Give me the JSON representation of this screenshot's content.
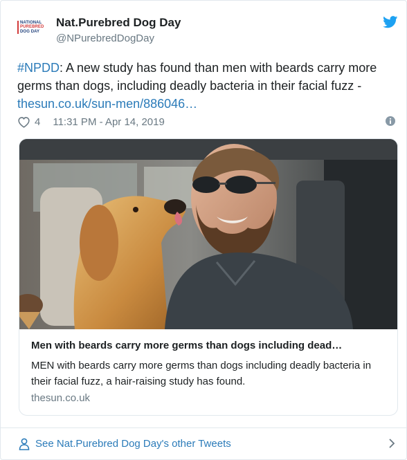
{
  "author": {
    "name": "Nat.Purebred Dog Day",
    "handle": "@NPurebredDogDay",
    "avatar_lines": [
      "NATIONAL",
      "PUREBRED",
      "DOG DAY"
    ]
  },
  "tweet": {
    "hashtag": "#NPDD",
    "text": ": A new study has found than men with beards carry more germs than dogs, including deadly bacteria in their facial fuzz - ",
    "link": "thesun.co.uk/sun-men/886046…",
    "likes": "4",
    "timestamp": "11:31 PM - Apr 14, 2019"
  },
  "card": {
    "title": "Men with beards carry more germs than dogs including dead…",
    "description": "MEN with beards carry more germs than dogs including deadly bacteria in their facial fuzz, a hair-raising study has found.",
    "domain": "thesun.co.uk"
  },
  "footer": {
    "label": "See Nat.Purebred Dog Day's other Tweets"
  },
  "icons": {
    "logo": "twitter-bird-icon",
    "like": "heart-icon",
    "info": "info-icon",
    "profile": "person-icon",
    "more": "chevron-right-icon"
  },
  "colors": {
    "link": "#2b7bb9",
    "brand": "#1da1f2",
    "text": "#1c2022",
    "muted": "#697882",
    "border": "#e1e8ed"
  }
}
